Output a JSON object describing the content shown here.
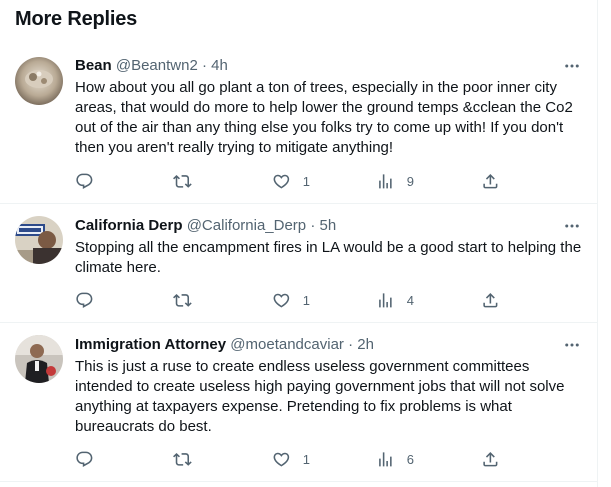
{
  "section": {
    "title": "More Replies"
  },
  "replies": [
    {
      "name": "Bean",
      "handle": "@Beantwn2",
      "dot": "·",
      "time": "4h",
      "text": "How about you all go plant a ton of trees, especially in the poor inner city areas, that would do more to help lower the ground temps &cclean the Co2 out of the air than any thing else you folks try to come up with! If you don't then you aren't really trying to mitigate anything!",
      "replies_count": "",
      "retweets_count": "",
      "likes_count": "1",
      "views_count": "9"
    },
    {
      "name": "California Derp",
      "handle": "@California_Derp",
      "dot": "·",
      "time": "5h",
      "text": "Stopping all the encampment fires in LA would be a good start to helping the climate here.",
      "replies_count": "",
      "retweets_count": "",
      "likes_count": "1",
      "views_count": "4"
    },
    {
      "name": "Immigration Attorney",
      "handle": "@moetandcaviar",
      "dot": "·",
      "time": "2h",
      "text": "This is just a ruse to create endless useless government  committees intended  to create useless high paying  government jobs that will not solve anything at taxpayers expense. Pretending to fix problems is what bureaucrats do best.",
      "replies_count": "",
      "retweets_count": "",
      "likes_count": "1",
      "views_count": "6"
    }
  ],
  "colors": {
    "text": "#0f1419",
    "secondary": "#536471",
    "divider": "#eff3f4"
  },
  "icons": [
    "more-icon",
    "reply-icon",
    "retweet-icon",
    "like-icon",
    "views-icon",
    "share-icon"
  ]
}
